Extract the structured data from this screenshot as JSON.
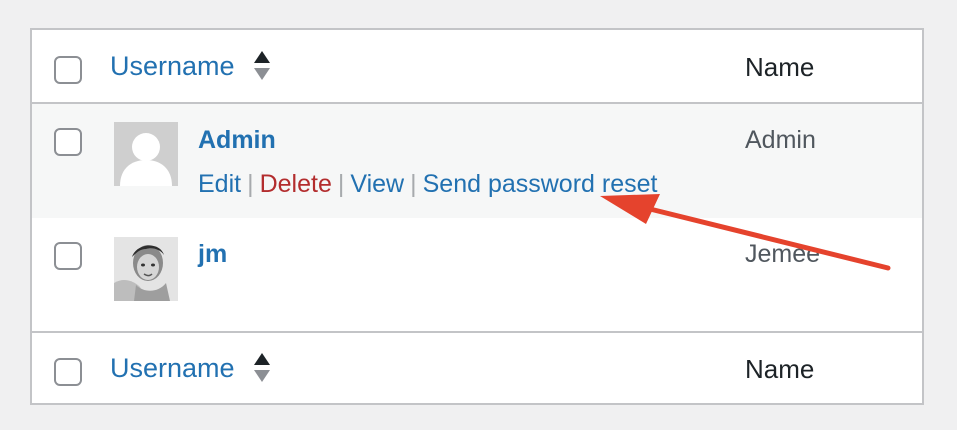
{
  "table": {
    "columns": {
      "username_label": "Username",
      "name_label": "Name"
    },
    "rows": [
      {
        "username": "Admin",
        "name": "Admin",
        "avatar": "default-avatar",
        "actions": {
          "edit": "Edit",
          "delete": "Delete",
          "view": "View",
          "reset": "Send password reset",
          "separator": "|"
        }
      },
      {
        "username": "jm",
        "name": "Jemee",
        "avatar": "photo-avatar"
      }
    ]
  },
  "colors": {
    "link": "#2271b1",
    "delete": "#b32d2e",
    "annotation_arrow": "#e5432d"
  },
  "icons": {
    "sort": "sort-arrows-icon",
    "annotation": "annotation-arrow-icon"
  }
}
